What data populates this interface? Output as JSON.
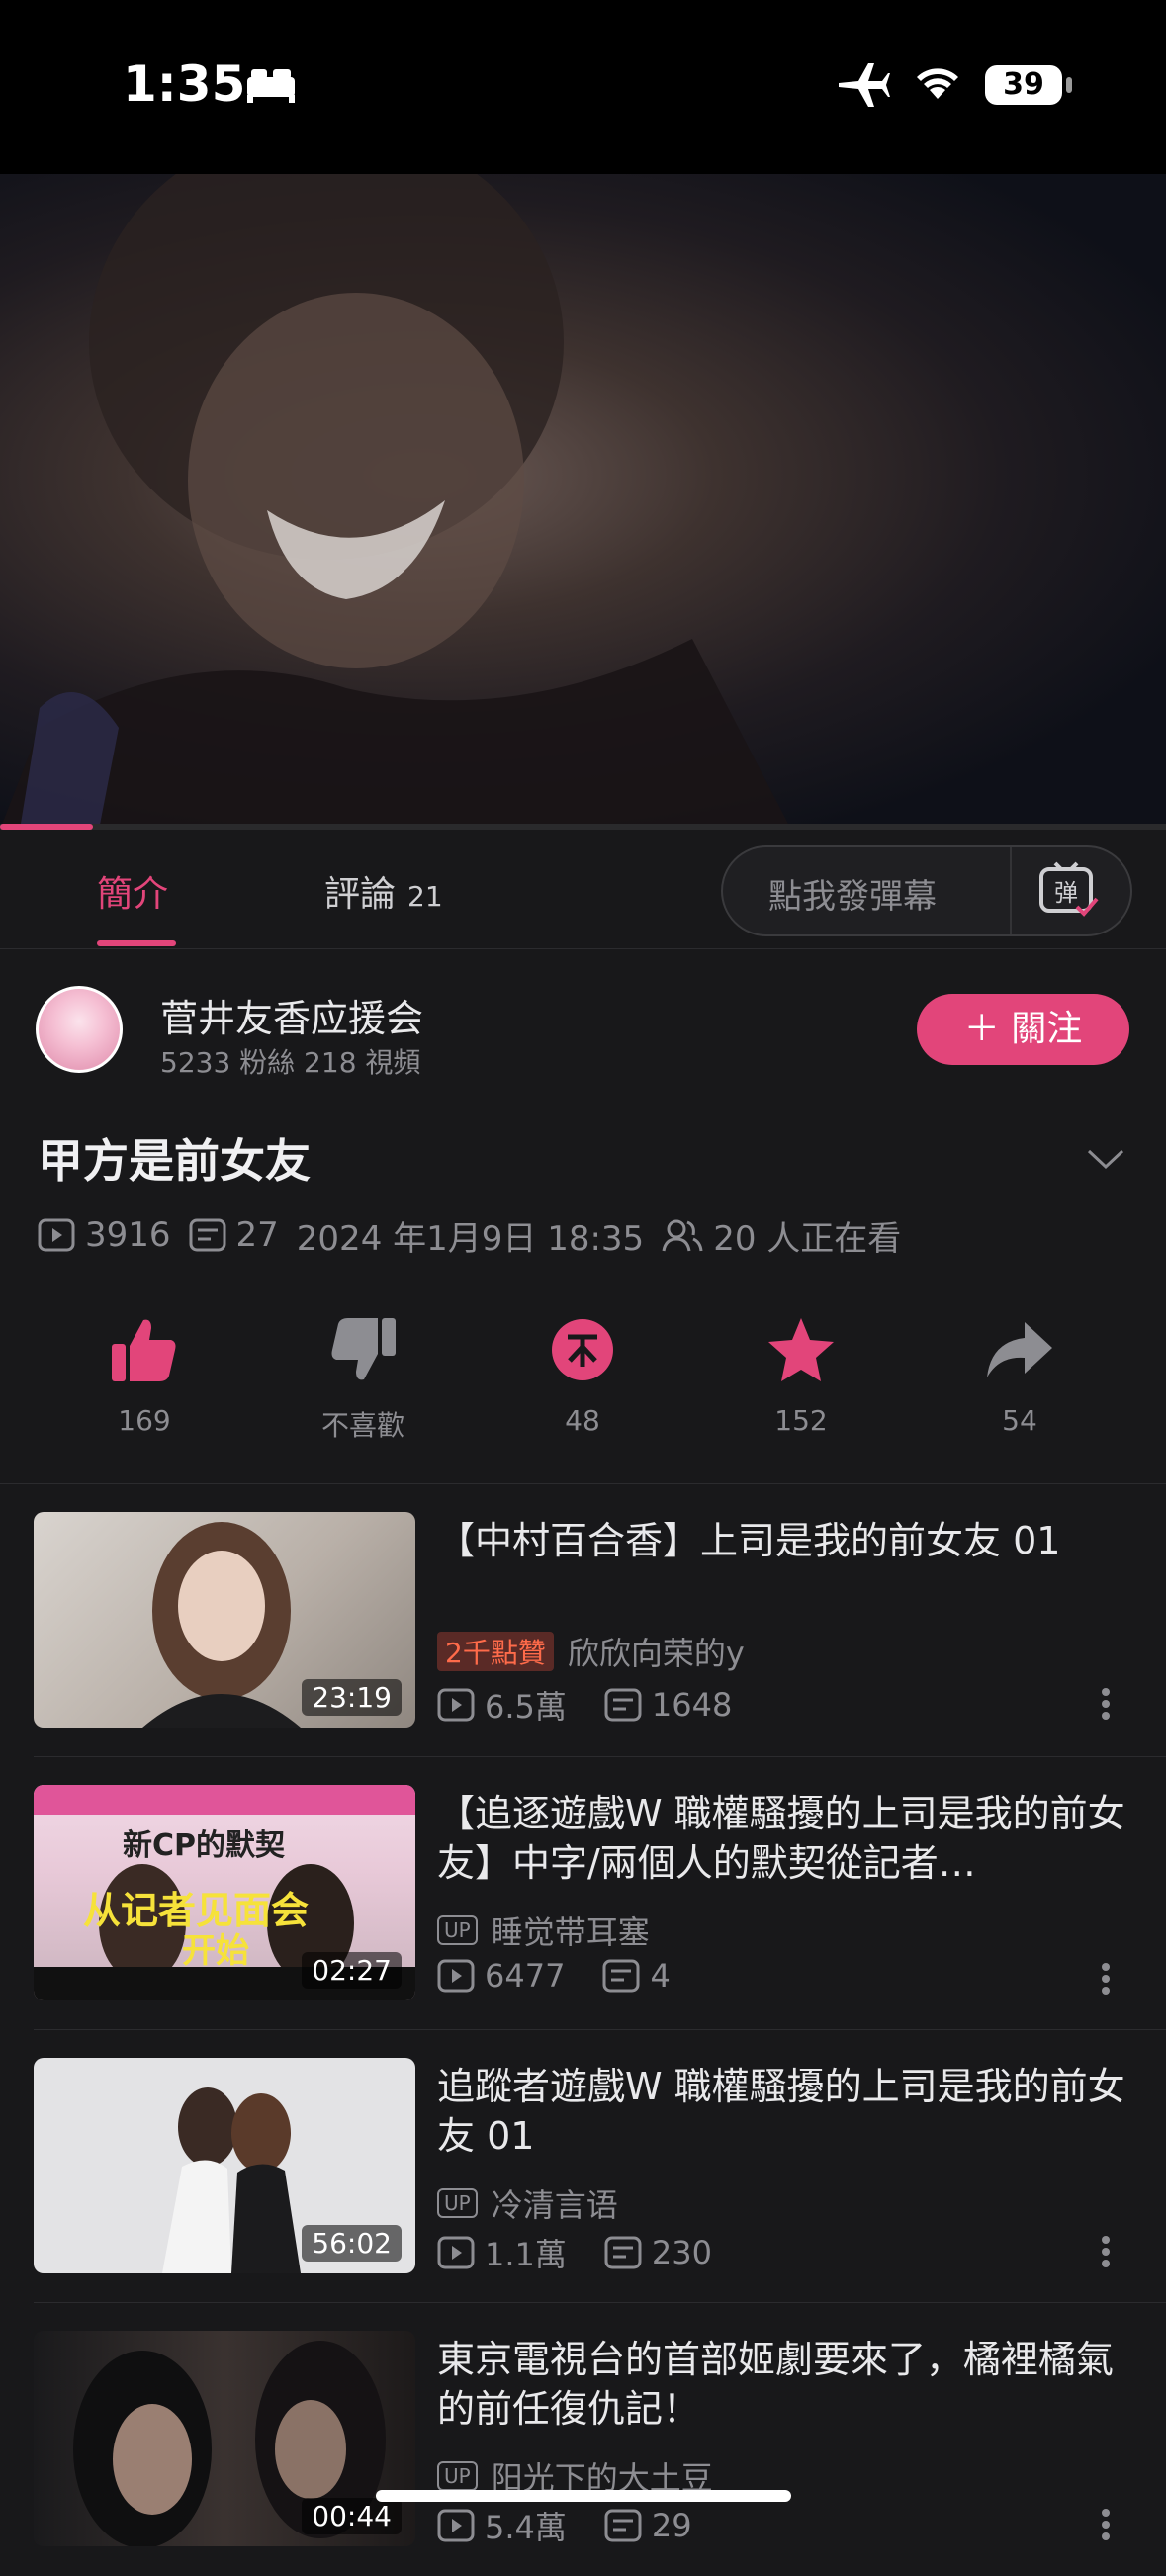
{
  "status_bar": {
    "time": "1:35",
    "battery": "39"
  },
  "tabs": {
    "intro": "簡介",
    "comments": "評論",
    "comments_count": "21",
    "danmaku_placeholder": "點我發彈幕",
    "danmaku_icon_text": "弹"
  },
  "uploader": {
    "name": "菅井友香应援会",
    "stats": "5233 粉絲  218 視頻",
    "follow_label": "＋ 關注"
  },
  "video": {
    "title": "甲方是前女友",
    "views": "3916",
    "danmaku": "27",
    "date": "2024 年1月9日 18:35",
    "watching": "20 人正在看",
    "progress": 0.08
  },
  "actions": [
    {
      "name": "like",
      "label": "169"
    },
    {
      "name": "dislike",
      "label": "不喜歡"
    },
    {
      "name": "coin",
      "label": "48"
    },
    {
      "name": "favorite",
      "label": "152"
    },
    {
      "name": "share",
      "label": "54"
    }
  ],
  "recommendations": [
    {
      "title": "【中村百合香】上司是我的前女友  01",
      "hot": "2千點贊",
      "author": "欣欣向荣的y",
      "views": "6.5萬",
      "danmaku": "1648",
      "duration": "23:19"
    },
    {
      "title": "【追逐遊戲W  職權騷擾的上司是我的前女友】中字/兩個人的默契從記者…",
      "author": "睡觉带耳塞",
      "views": "6477",
      "danmaku": "4",
      "duration": "02:27",
      "thumb_text_1": "新CP的默契",
      "thumb_text_2": "从记者见面会",
      "thumb_text_3": "开始"
    },
    {
      "title": "追蹤者遊戲W  職權騷擾的上司是我的前女友  01",
      "author": "冷清言语",
      "views": "1.1萬",
      "danmaku": "230",
      "duration": "56:02"
    },
    {
      "title": "東京電視台的首部姬劇要來了，橘裡橘氣的前任復仇記！",
      "author": "阳光下的大土豆",
      "views": "5.4萬",
      "danmaku": "29",
      "duration": "00:44"
    }
  ],
  "labels": {
    "up": "UP"
  }
}
